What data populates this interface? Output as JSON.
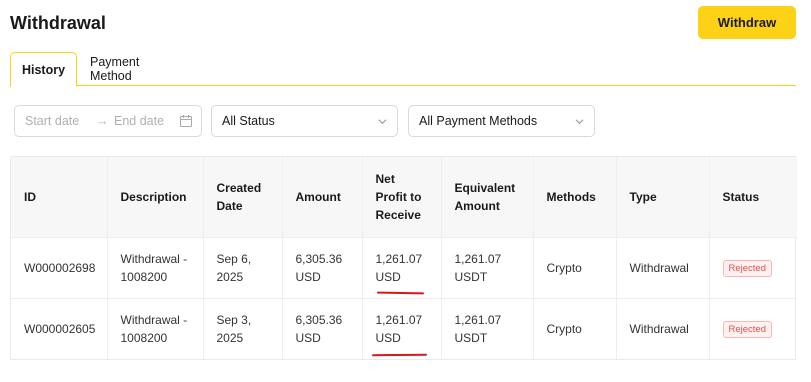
{
  "page": {
    "title": "Withdrawal"
  },
  "header": {
    "withdraw_button": "Withdraw"
  },
  "tabs": [
    {
      "label": "History",
      "active": true
    },
    {
      "label": "Payment Method",
      "active": false
    }
  ],
  "filters": {
    "start_placeholder": "Start date",
    "end_placeholder": "End date",
    "status_value": "All Status",
    "method_value": "All Payment Methods"
  },
  "table": {
    "columns": [
      [
        "ID"
      ],
      [
        "Description"
      ],
      [
        "Created",
        "Date"
      ],
      [
        "Amount"
      ],
      [
        "Net",
        "Profit to",
        "Receive"
      ],
      [
        "Equivalent",
        "Amount"
      ],
      [
        "Methods"
      ],
      [
        "Type"
      ],
      [
        "Status"
      ]
    ],
    "rows": [
      {
        "id": "W000002698",
        "description": [
          "Withdrawal -",
          "1008200"
        ],
        "created": [
          "Sep 6,",
          "2025"
        ],
        "amount": [
          "6,305.36",
          "USD"
        ],
        "net": [
          "1,261.07",
          "USD"
        ],
        "equivalent": [
          "1,261.07",
          "USDT"
        ],
        "method": "Crypto",
        "type": "Withdrawal",
        "status": "Rejected"
      },
      {
        "id": "W000002605",
        "description": [
          "Withdrawal -",
          "1008200"
        ],
        "created": [
          "Sep 3,",
          "2025"
        ],
        "amount": [
          "6,305.36",
          "USD"
        ],
        "net": [
          "1,261.07",
          "USD"
        ],
        "equivalent": [
          "1,261.07",
          "USDT"
        ],
        "method": "Crypto",
        "type": "Withdrawal",
        "status": "Rejected"
      }
    ]
  },
  "icons": {
    "calendar": "calendar-icon",
    "arrow": "arrow-right-icon",
    "chevron": "chevron-down-icon"
  },
  "colors": {
    "accent": "#fcd116",
    "rejected": "#e0524f",
    "annotation": "#d6171b"
  }
}
